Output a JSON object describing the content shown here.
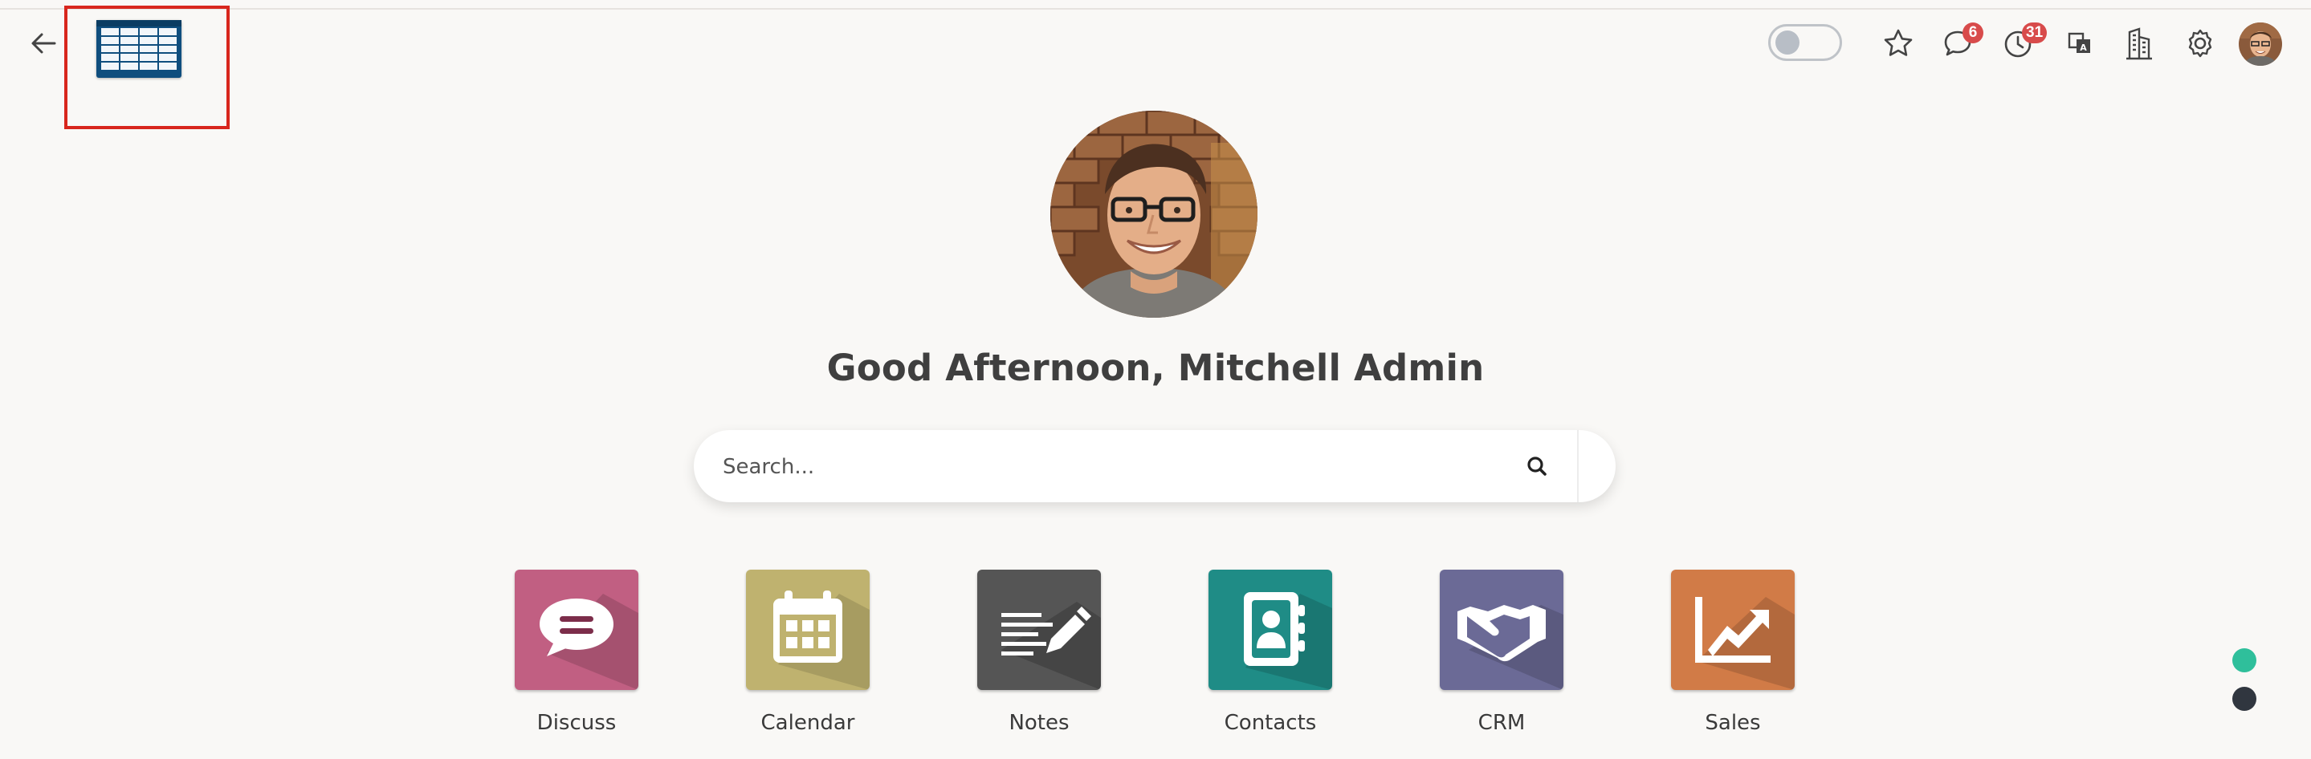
{
  "header": {
    "back_label": "Back",
    "notifications": {
      "messages_count": "6",
      "activities_count": "31"
    },
    "icons": [
      "arrow-left-icon",
      "star-icon",
      "chat-bubble-icon",
      "clock-icon",
      "translate-icon",
      "building-icon",
      "gear-icon"
    ]
  },
  "greeting": "Good Afternoon, Mitchell Admin",
  "search": {
    "placeholder": "Search...",
    "value": ""
  },
  "apps": [
    {
      "label": "Discuss",
      "color": "#c15f82",
      "icon": "speech-bubble-icon"
    },
    {
      "label": "Calendar",
      "color": "#bfb26f",
      "icon": "calendar-icon"
    },
    {
      "label": "Notes",
      "color": "#555555",
      "icon": "notes-icon"
    },
    {
      "label": "Contacts",
      "color": "#1f8c86",
      "icon": "address-book-icon"
    },
    {
      "label": "CRM",
      "color": "#6b6a96",
      "icon": "handshake-icon"
    },
    {
      "label": "Sales",
      "color": "#d17b47",
      "icon": "chart-up-icon"
    }
  ],
  "colors": {
    "background": "#f9f8f6",
    "badge": "#d84b4b",
    "dot_active": "#2fbf9b",
    "dot_inactive": "#30363f",
    "highlight": "#d8261d"
  }
}
